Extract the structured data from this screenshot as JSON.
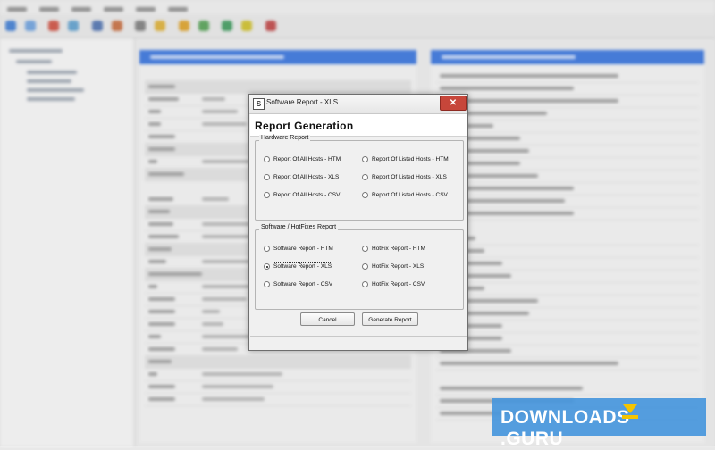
{
  "dialog": {
    "title": "Software Report  - XLS",
    "close_label": "✕",
    "heading": "Report Generation",
    "hardware_group": {
      "legend": "Hardware Report",
      "options": [
        {
          "label": "Report Of All Hosts - HTM",
          "selected": false
        },
        {
          "label": "Report Of Listed Hosts - HTM",
          "selected": false
        },
        {
          "label": "Report Of All Hosts - XLS",
          "selected": false
        },
        {
          "label": "Report Of Listed Hosts - XLS",
          "selected": false
        },
        {
          "label": "Report Of All Hosts - CSV",
          "selected": false
        },
        {
          "label": "Report Of Listed Hosts - CSV",
          "selected": false
        }
      ]
    },
    "software_group": {
      "legend": "Software / HotFixes Report",
      "options": [
        {
          "label": "Software Report  - HTM",
          "selected": false
        },
        {
          "label": "HotFix Report - HTM",
          "selected": false
        },
        {
          "label": "Software Report  - XLS",
          "selected": true
        },
        {
          "label": "HotFix Report - XLS",
          "selected": false
        },
        {
          "label": "Software Report  - CSV",
          "selected": false
        },
        {
          "label": "HotFix Report - CSV",
          "selected": false
        }
      ]
    },
    "buttons": {
      "cancel": "Cancel",
      "generate": "Generate Report"
    }
  },
  "watermark": {
    "text": "DOWNLOADS",
    "suffix": ".GURU"
  },
  "colors": {
    "panel_header": "#2f6fe0",
    "watermark_bg": "#4696dc",
    "watermark_accent": "#f5c400"
  }
}
